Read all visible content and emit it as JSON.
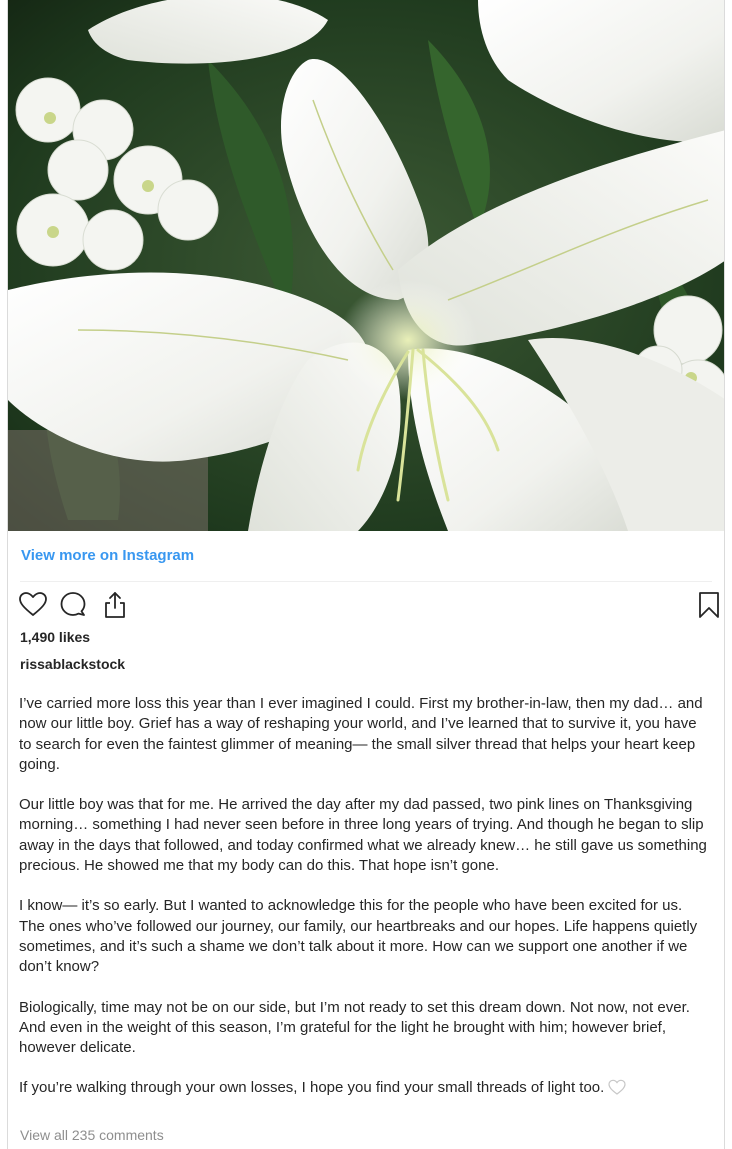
{
  "post": {
    "image_alt_name": "white-lilies-photo",
    "view_more_label": "View more on Instagram",
    "likes": "1,490 likes",
    "username": "rissablackstock",
    "caption": [
      "I’ve carried more loss this year than I ever imagined I could. First my brother-in-law, then my dad… and now our little boy. Grief has a way of reshaping your world, and I’ve learned that to survive it, you have to search for even the faintest glimmer of meaning— the small silver thread that helps your heart keep going.",
      "Our little boy was that for me. He arrived the day after my dad passed, two pink lines on Thanksgiving morning… something I had never seen before in three long years of trying. And though he began to slip away in the days that followed, and today confirmed what we already knew… he still gave us something precious. He showed me that my body can do this. That hope isn’t gone.",
      "I know— it’s so early. But I wanted to acknowledge this for the people who have been excited for us. The ones who’ve followed our journey, our family, our heartbreaks and our hopes. Life happens quietly sometimes, and it’s such a shame we don’t talk about it more. How can we support one another if we don’t know?",
      "Biologically, time may not be on our side, but I’m not ready to set this dream down. Not now, not ever. And even in the weight of this season, I’m grateful for the light he brought with him; however brief, however delicate.",
      "If you’re walking through your own losses, I hope you find your small threads of light too."
    ],
    "view_comments_label": "View all 235 comments"
  },
  "icons": {
    "like": "heart-icon",
    "comment": "comment-icon",
    "share": "share-icon",
    "save": "bookmark-icon",
    "caption_emoji": "white-heart-icon"
  },
  "colors": {
    "link_blue": "#3897f0",
    "text": "#262626",
    "muted": "#8e8e8e",
    "border": "#dbdbdb"
  }
}
